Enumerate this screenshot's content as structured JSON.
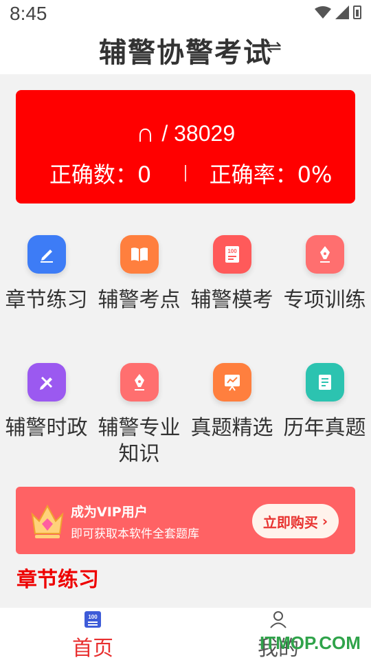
{
  "status": {
    "time": "8:45"
  },
  "header": {
    "title": "辅警协警考试",
    "switch_glyph": "⇌"
  },
  "score": {
    "done": "∩",
    "total": "/ 38029",
    "correct_count": "正确数：0",
    "correct_rate": "正确率：0%"
  },
  "grid_row1": [
    {
      "label": "章节练习",
      "icon": "pencil-edit-icon",
      "color": "#3d7cf6"
    },
    {
      "label": "辅警考点",
      "icon": "book-icon",
      "color": "#ff7f3e"
    },
    {
      "label": "辅警模考",
      "icon": "exam-100-icon",
      "color": "#ff5a5a"
    },
    {
      "label": "专项训练",
      "icon": "pen-icon",
      "color": "#ff6f6f"
    }
  ],
  "grid_row2": [
    {
      "label": "辅警时政",
      "icon": "pen-cross-icon",
      "color": "#9b59f0"
    },
    {
      "label": "辅警专业知识",
      "icon": "pen-icon",
      "color": "#ff6f6f"
    },
    {
      "label": "真题精选",
      "icon": "chart-board-icon",
      "color": "#ff7f3e"
    },
    {
      "label": "历年真题",
      "icon": "document-icon",
      "color": "#2cc3b0"
    }
  ],
  "vip": {
    "title": "成为VIP用户",
    "subtitle": "即可获取本软件全套题库",
    "button": "立即购买"
  },
  "section": {
    "title": "章节练习"
  },
  "nav": {
    "home_label": "首页",
    "mine_label": "我的",
    "active_color": "#e82f2f"
  },
  "watermark": "ITMOP.COM"
}
